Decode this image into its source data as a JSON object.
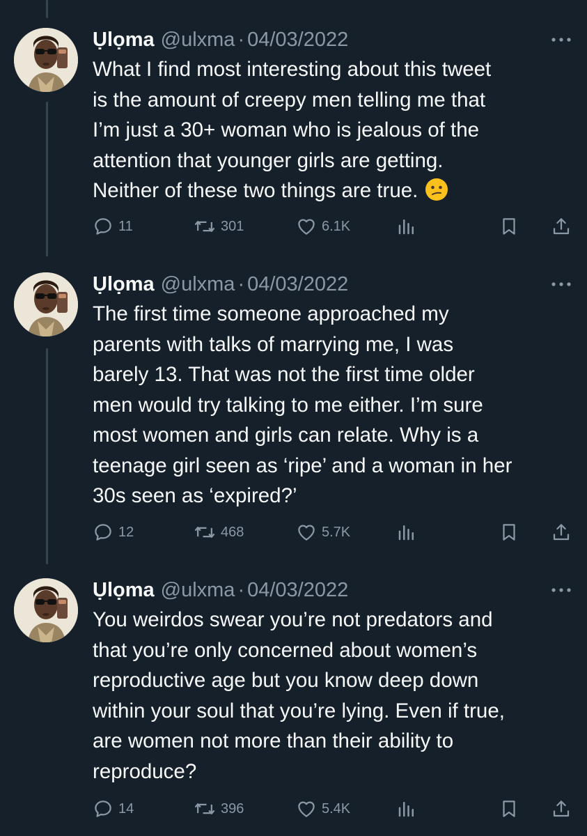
{
  "tweets": [
    {
      "display_name": "Ụlọma",
      "handle": "@ulxma",
      "separator": "·",
      "date": "04/03/2022",
      "lines": [
        "What I find most interesting about this tweet",
        "is the amount of creepy men telling me that",
        "I’m just a 30+ woman who is jealous of the",
        "attention that younger girls are getting.",
        "Neither of these two things are true."
      ],
      "emoji": "confused-face-emoji",
      "replies": "11",
      "retweets": "301",
      "likes": "6.1K"
    },
    {
      "display_name": "Ụlọma",
      "handle": "@ulxma",
      "separator": "·",
      "date": "04/03/2022",
      "lines": [
        "The first time someone approached my",
        "parents with talks of marrying me, I was",
        "barely 13. That was not the first time older",
        "men would try talking to me either. I’m sure",
        "most women and girls can relate. Why is a",
        "teenage girl seen as ‘ripe’ and a woman in her",
        "30s seen as ‘expired?’"
      ],
      "replies": "12",
      "retweets": "468",
      "likes": "5.7K"
    },
    {
      "display_name": "Ụlọma",
      "handle": "@ulxma",
      "separator": "·",
      "date": "04/03/2022",
      "lines": [
        "You weirdos swear you’re not predators and",
        "that you’re only concerned about women’s",
        "reproductive age but you know deep down",
        "within your soul that you’re lying. Even if true,",
        "are women not more than their ability to",
        "reproduce?"
      ],
      "replies": "14",
      "retweets": "396",
      "likes": "5.4K"
    }
  ],
  "icons": {
    "reply": "reply-icon",
    "retweet": "retweet-icon",
    "like": "heart-icon",
    "views": "views-icon",
    "bookmark": "bookmark-icon",
    "share": "share-icon",
    "more": "more-icon"
  },
  "colors": {
    "background": "#15202b",
    "text": "#f7f9f9",
    "secondary": "#8b98a5",
    "thread_line": "#38444d"
  }
}
